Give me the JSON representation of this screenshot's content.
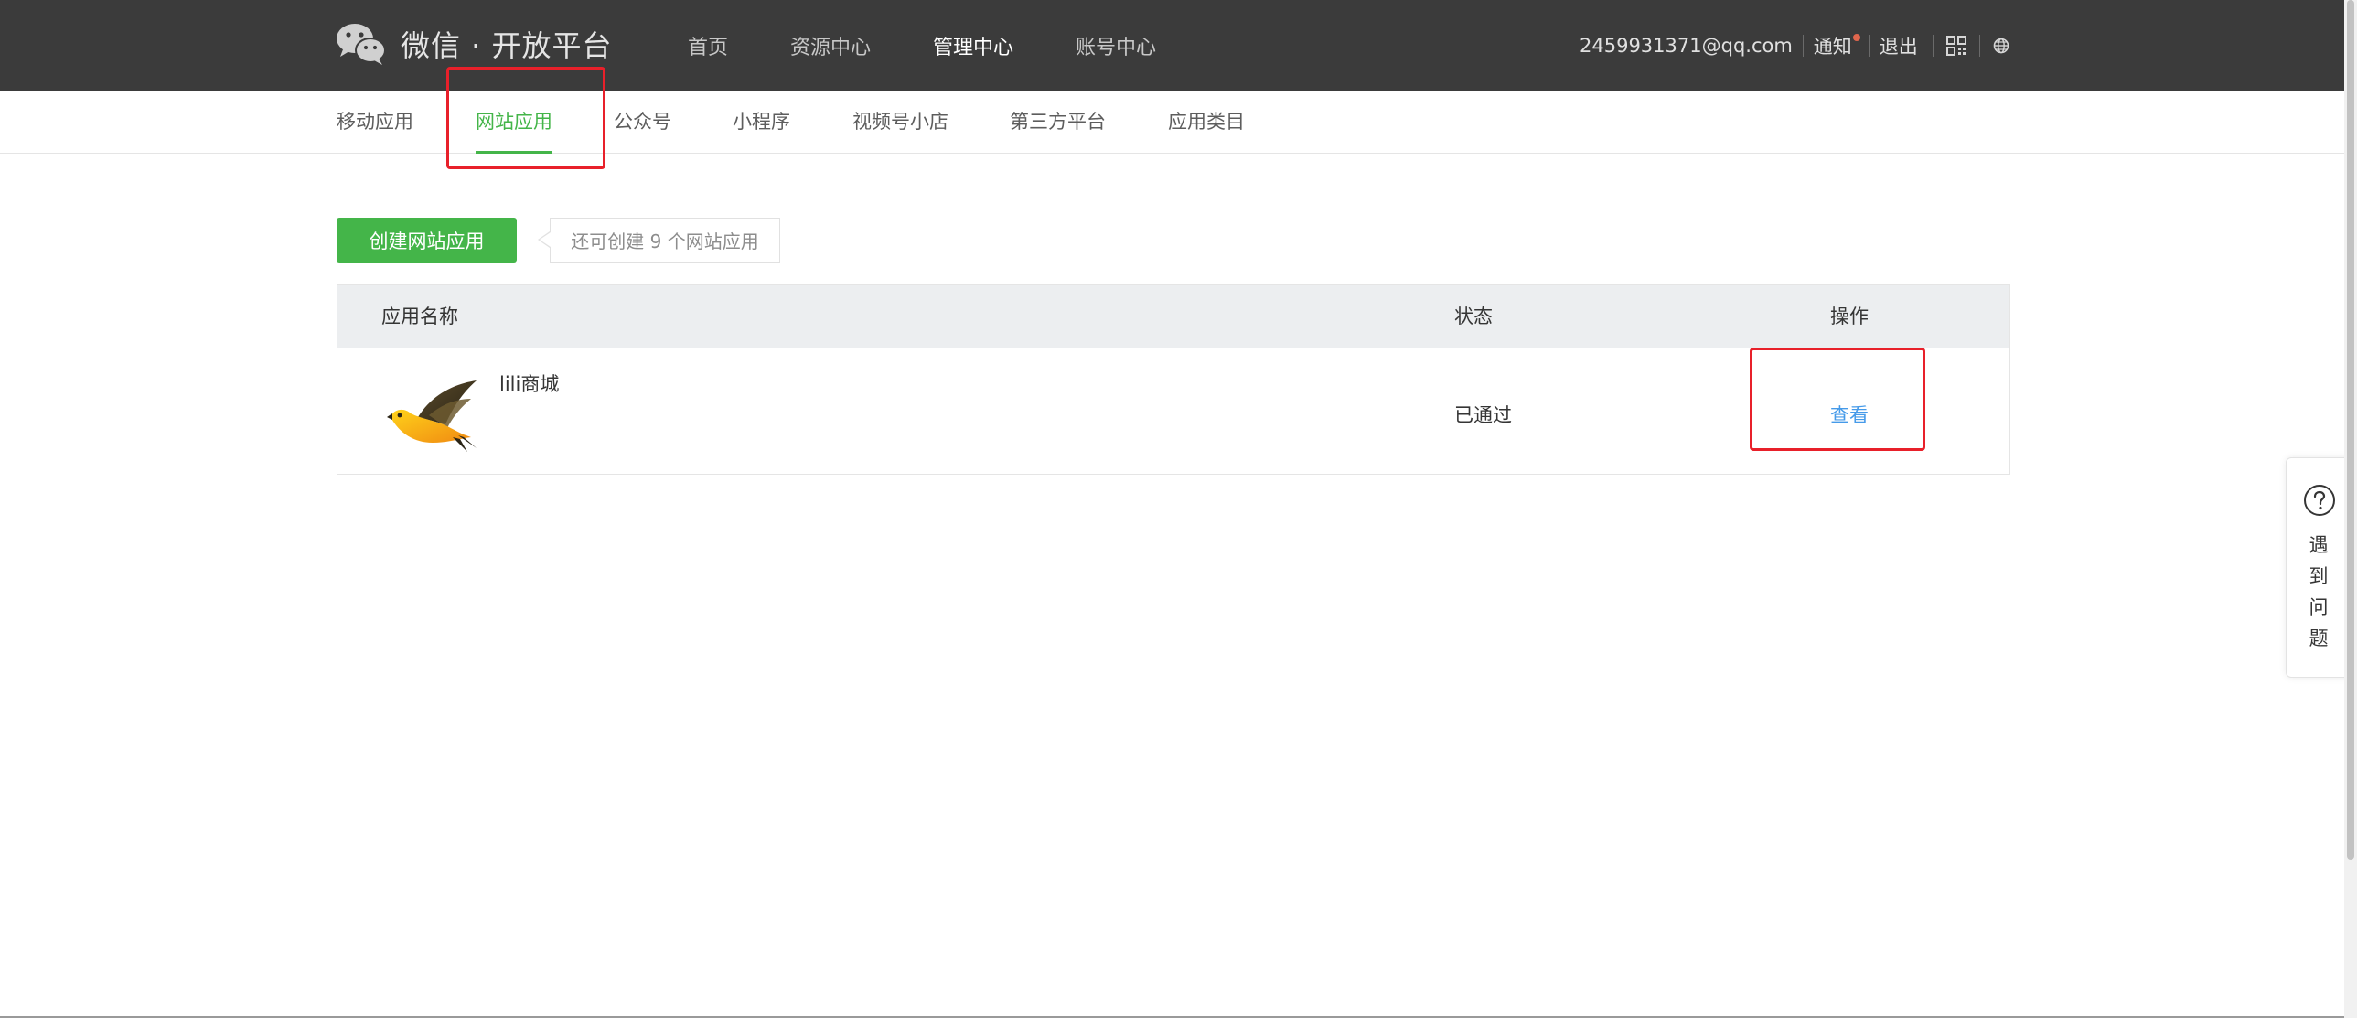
{
  "header": {
    "brand": "微信 · 开放平台",
    "nav": [
      {
        "label": "首页",
        "active": false
      },
      {
        "label": "资源中心",
        "active": false
      },
      {
        "label": "管理中心",
        "active": true
      },
      {
        "label": "账号中心",
        "active": false
      }
    ],
    "email": "2459931371@qq.com",
    "notice_label": "通知",
    "logout_label": "退出",
    "qr_icon": "qrcode-icon",
    "globe_icon": "globe-icon"
  },
  "subnav": {
    "items": [
      {
        "label": "移动应用"
      },
      {
        "label": "网站应用"
      },
      {
        "label": "公众号"
      },
      {
        "label": "小程序"
      },
      {
        "label": "视频号小店"
      },
      {
        "label": "第三方平台"
      },
      {
        "label": "应用类目"
      }
    ],
    "active_index": 1
  },
  "create": {
    "button_label": "创建网站应用",
    "tip": "还可创建 9 个网站应用"
  },
  "table": {
    "columns": [
      "应用名称",
      "状态",
      "操作"
    ],
    "rows": [
      {
        "name": "lili商城",
        "status": "已通过",
        "action": "查看",
        "icon": "bird-logo-icon"
      }
    ]
  },
  "help": {
    "chars": [
      "遇",
      "到",
      "问",
      "题"
    ]
  },
  "colors": {
    "header_bg": "#3b3b3b",
    "accent_green": "#44b549",
    "link_blue": "#459ae9",
    "highlight_red": "#e8202a",
    "notice_dot": "#e0664d"
  }
}
